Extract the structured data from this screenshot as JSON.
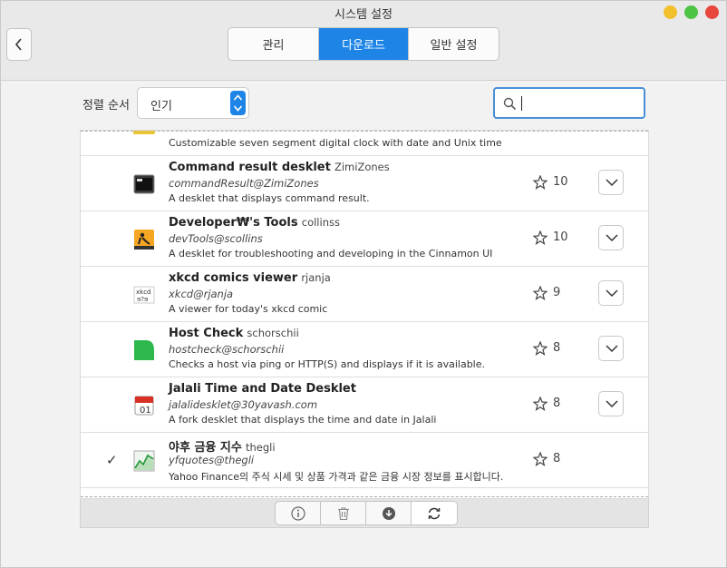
{
  "window": {
    "title": "시스템 설정"
  },
  "tabs": [
    {
      "label": "관리",
      "active": false
    },
    {
      "label": "다운로드",
      "active": true
    },
    {
      "label": "일반 설정",
      "active": false
    }
  ],
  "sort": {
    "label": "정렬 순서",
    "value": "인기"
  },
  "search": {
    "value": ""
  },
  "partial_top": {
    "desc": "Customizable seven segment digital clock with date and Unix time"
  },
  "rows": [
    {
      "name": "Command result desklet",
      "author": "ZimiZones",
      "uuid": "commandResult@ZimiZones",
      "desc": "A desklet that displays command result.",
      "score": "10",
      "installed": false,
      "icon": "terminal-icon"
    },
    {
      "name": "Developer₩'s Tools",
      "author": "collinss",
      "uuid": "devTools@scollins",
      "desc": "A desklet for troubleshooting and developing in the Cinnamon UI",
      "score": "10",
      "installed": false,
      "icon": "construction-icon"
    },
    {
      "name": "xkcd comics viewer",
      "author": "rjanja",
      "uuid": "xkcd@rjanja",
      "desc": "A viewer for today's xkcd comic",
      "score": "9",
      "installed": false,
      "icon": "xkcd-icon"
    },
    {
      "name": "Host Check",
      "author": "schorschii",
      "uuid": "hostcheck@schorschii",
      "desc": "Checks a host via ping or HTTP(S) and displays if it is available.",
      "score": "8",
      "installed": false,
      "icon": "host-check-icon"
    },
    {
      "name": "Jalali Time and Date Desklet",
      "author": "",
      "uuid": "jalalidesklet@30yavash.com",
      "desc": "A fork desklet that displays the time and date in Jalali",
      "score": "8",
      "installed": false,
      "icon": "calendar-icon"
    },
    {
      "name": "야후 금융 지수",
      "author": "thegli",
      "uuid": "yfquotes@thegli",
      "desc": "Yahoo Finance의 주식 시세 및 상품 가격과 같은 금융 시장 정보를 표시합니다.",
      "score": "8",
      "installed": true,
      "icon": "stock-chart-icon"
    }
  ],
  "colors": {
    "accent": "#1e85e6"
  }
}
